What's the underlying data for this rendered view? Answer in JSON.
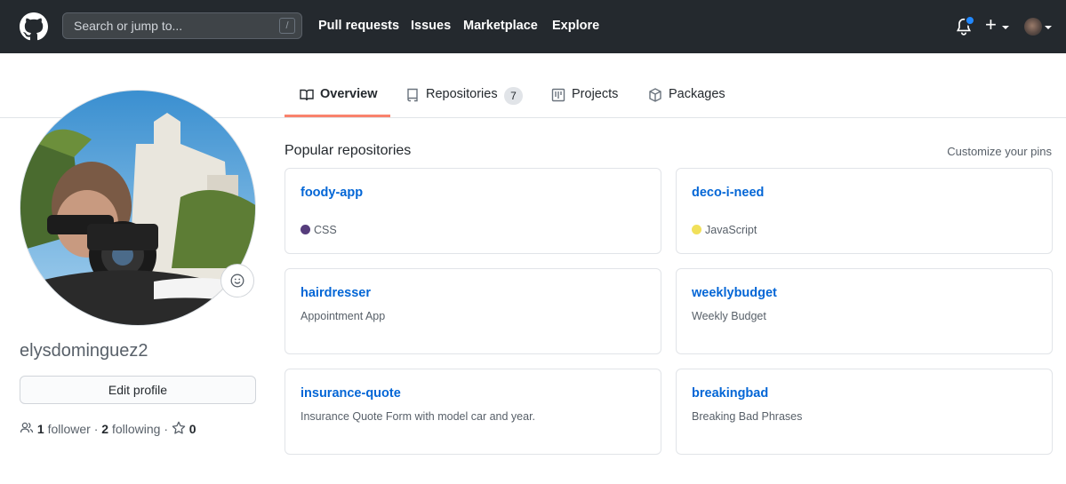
{
  "header": {
    "search_placeholder": "Search or jump to...",
    "search_shortcut": "/",
    "nav": [
      "Pull requests",
      "Issues",
      "Marketplace",
      "Explore"
    ],
    "plus_label": "+"
  },
  "tabs": [
    {
      "label": "Overview",
      "active": true,
      "icon": "book-icon"
    },
    {
      "label": "Repositories",
      "count": "7",
      "icon": "repo-icon"
    },
    {
      "label": "Projects",
      "icon": "project-icon"
    },
    {
      "label": "Packages",
      "icon": "package-icon"
    }
  ],
  "profile": {
    "username": "elysdominguez2",
    "edit_label": "Edit profile",
    "followers_count": "1",
    "followers_label": "follower",
    "following_count": "2",
    "following_label": "following",
    "stars_count": "0"
  },
  "repos_section": {
    "title": "Popular repositories",
    "customize": "Customize your pins",
    "repos": [
      {
        "name": "foody-app",
        "language": "CSS",
        "language_color": "#563d7c"
      },
      {
        "name": "deco-i-need",
        "language": "JavaScript",
        "language_color": "#f1e05a"
      },
      {
        "name": "hairdresser",
        "description": "Appointment App"
      },
      {
        "name": "weeklybudget",
        "description": "Weekly Budget"
      },
      {
        "name": "insurance-quote",
        "description": "Insurance Quote Form with model car and year."
      },
      {
        "name": "breakingbad",
        "description": "Breaking Bad Phrases"
      }
    ]
  },
  "colors": {
    "header_bg": "#24292e",
    "link": "#0366d6",
    "active_tab_underline": "#f9826c",
    "notification_dot": "#2188ff"
  }
}
